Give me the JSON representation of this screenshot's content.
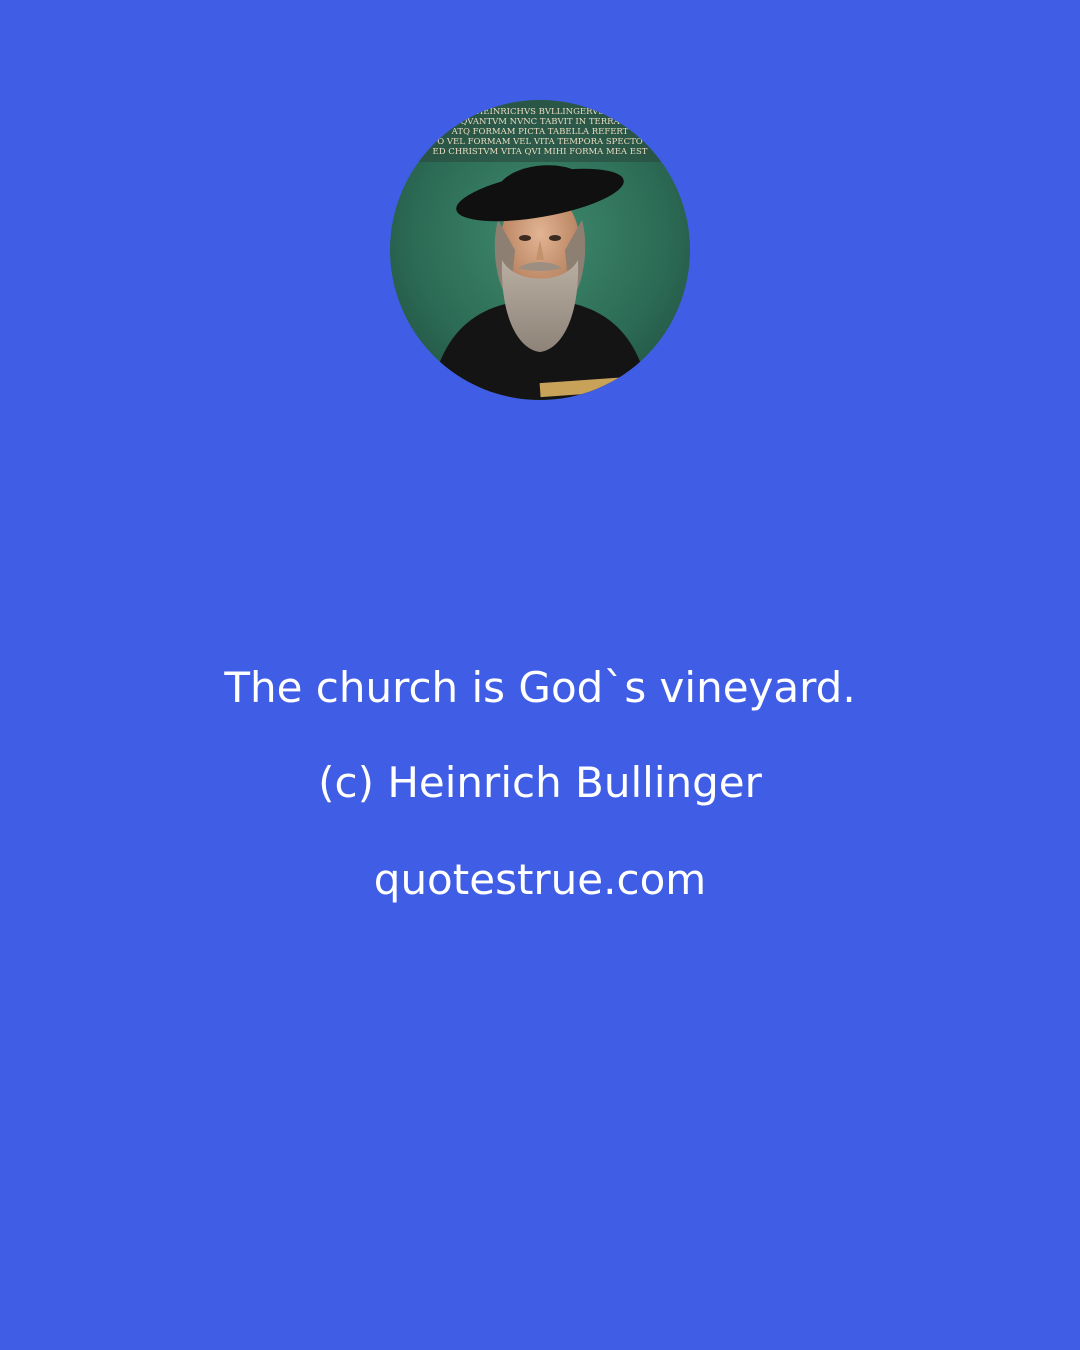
{
  "quote": {
    "text": "The church is God`s vineyard.",
    "author": "(c) Heinrich Bullinger",
    "site": "quotestrue.com"
  },
  "portrait": {
    "subject": "Heinrich Bullinger",
    "inscription_lines": [
      "HEINRICHVS BVLLINGERVS",
      "QVANTVM NVNC TABVIT IN TERRA",
      "ATQ FORMAM PICTA TABELLA REFERT",
      "O VEL FORMAM VEL VITA TEMPORA SPECTO",
      "ED CHRISTVM VITA QVI MIHI FORMA MEA EST"
    ]
  },
  "colors": {
    "background": "#405ee5",
    "text": "#ffffff"
  }
}
